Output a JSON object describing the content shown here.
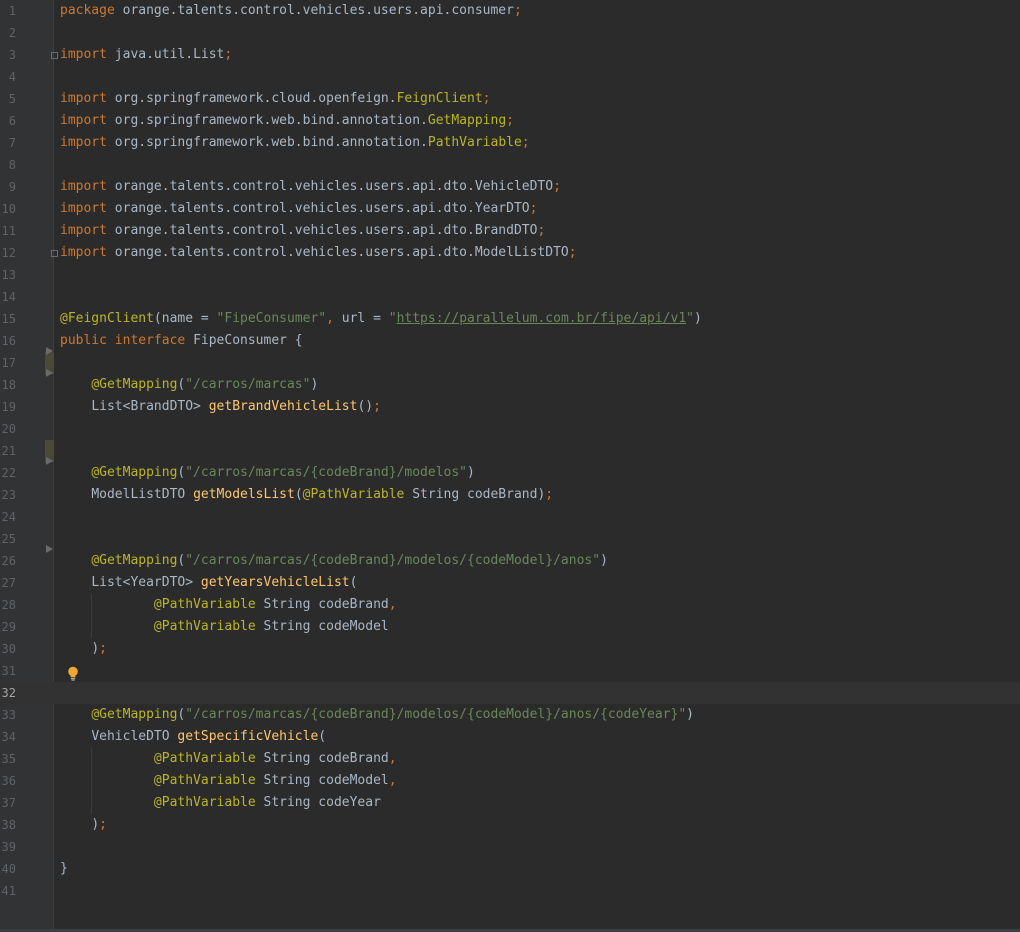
{
  "editor": {
    "current_line": 32,
    "lines": [
      {
        "n": "1",
        "tokens": [
          {
            "t": "package ",
            "c": "kw"
          },
          {
            "t": "orange.talents.control.vehicles.users.api.consumer",
            "c": "id"
          },
          {
            "t": ";",
            "c": "kw"
          }
        ]
      },
      {
        "n": "2",
        "tokens": []
      },
      {
        "n": "3",
        "tokens": [
          {
            "t": "import ",
            "c": "kw"
          },
          {
            "t": "java.util.List",
            "c": "id"
          },
          {
            "t": ";",
            "c": "kw"
          }
        ]
      },
      {
        "n": "4",
        "tokens": []
      },
      {
        "n": "5",
        "tokens": [
          {
            "t": "import ",
            "c": "kw"
          },
          {
            "t": "org.springframework.cloud.openfeign.",
            "c": "id"
          },
          {
            "t": "FeignClient",
            "c": "im"
          },
          {
            "t": ";",
            "c": "kw"
          }
        ]
      },
      {
        "n": "6",
        "tokens": [
          {
            "t": "import ",
            "c": "kw"
          },
          {
            "t": "org.springframework.web.bind.annotation.",
            "c": "id"
          },
          {
            "t": "GetMapping",
            "c": "im"
          },
          {
            "t": ";",
            "c": "kw"
          }
        ]
      },
      {
        "n": "7",
        "tokens": [
          {
            "t": "import ",
            "c": "kw"
          },
          {
            "t": "org.springframework.web.bind.annotation.",
            "c": "id"
          },
          {
            "t": "PathVariable",
            "c": "im"
          },
          {
            "t": ";",
            "c": "kw"
          }
        ]
      },
      {
        "n": "8",
        "tokens": []
      },
      {
        "n": "9",
        "tokens": [
          {
            "t": "import ",
            "c": "kw"
          },
          {
            "t": "orange.talents.control.vehicles.users.api.dto.VehicleDTO",
            "c": "id"
          },
          {
            "t": ";",
            "c": "kw"
          }
        ]
      },
      {
        "n": "10",
        "tokens": [
          {
            "t": "import ",
            "c": "kw"
          },
          {
            "t": "orange.talents.control.vehicles.users.api.dto.YearDTO",
            "c": "id"
          },
          {
            "t": ";",
            "c": "kw"
          }
        ]
      },
      {
        "n": "11",
        "tokens": [
          {
            "t": "import ",
            "c": "kw"
          },
          {
            "t": "orange.talents.control.vehicles.users.api.dto.BrandDTO",
            "c": "id"
          },
          {
            "t": ";",
            "c": "kw"
          }
        ]
      },
      {
        "n": "12",
        "tokens": [
          {
            "t": "import ",
            "c": "kw"
          },
          {
            "t": "orange.talents.control.vehicles.users.api.dto.ModelListDTO",
            "c": "id"
          },
          {
            "t": ";",
            "c": "kw"
          }
        ]
      },
      {
        "n": "13",
        "tokens": []
      },
      {
        "n": "14",
        "tokens": []
      },
      {
        "n": "15",
        "tokens": [
          {
            "t": "@FeignClient",
            "c": "ann"
          },
          {
            "t": "(name = ",
            "c": "id"
          },
          {
            "t": "\"FipeConsumer\"",
            "c": "str"
          },
          {
            "t": ", ",
            "c": "kw"
          },
          {
            "t": "url = ",
            "c": "id"
          },
          {
            "t": "\"",
            "c": "str"
          },
          {
            "t": "https://parallelum.com.br/fipe/api/v1",
            "c": "url"
          },
          {
            "t": "\"",
            "c": "str"
          },
          {
            "t": ")",
            "c": "id"
          }
        ]
      },
      {
        "n": "16",
        "tokens": [
          {
            "t": "public interface ",
            "c": "kw"
          },
          {
            "t": "FipeConsumer {",
            "c": "id"
          }
        ]
      },
      {
        "n": "17",
        "tokens": []
      },
      {
        "n": "18",
        "tokens": [
          {
            "t": "    "
          },
          {
            "t": "@GetMapping",
            "c": "ann"
          },
          {
            "t": "(",
            "c": "id"
          },
          {
            "t": "\"/carros/marcas\"",
            "c": "str"
          },
          {
            "t": ")",
            "c": "id"
          }
        ]
      },
      {
        "n": "19",
        "tokens": [
          {
            "t": "    "
          },
          {
            "t": "List<BrandDTO> ",
            "c": "id"
          },
          {
            "t": "getBrandVehicleList",
            "c": "fn"
          },
          {
            "t": "()",
            "c": "id"
          },
          {
            "t": ";",
            "c": "kw"
          }
        ]
      },
      {
        "n": "20",
        "tokens": []
      },
      {
        "n": "21",
        "tokens": []
      },
      {
        "n": "22",
        "tokens": [
          {
            "t": "    "
          },
          {
            "t": "@GetMapping",
            "c": "ann"
          },
          {
            "t": "(",
            "c": "id"
          },
          {
            "t": "\"/carros/marcas/{codeBrand}/modelos\"",
            "c": "str"
          },
          {
            "t": ")",
            "c": "id"
          }
        ]
      },
      {
        "n": "23",
        "tokens": [
          {
            "t": "    "
          },
          {
            "t": "ModelListDTO ",
            "c": "id"
          },
          {
            "t": "getModelsList",
            "c": "fn"
          },
          {
            "t": "(",
            "c": "id"
          },
          {
            "t": "@PathVariable ",
            "c": "ann"
          },
          {
            "t": "String codeBrand)",
            "c": "id"
          },
          {
            "t": ";",
            "c": "kw"
          }
        ]
      },
      {
        "n": "24",
        "tokens": []
      },
      {
        "n": "25",
        "tokens": []
      },
      {
        "n": "26",
        "tokens": [
          {
            "t": "    "
          },
          {
            "t": "@GetMapping",
            "c": "ann"
          },
          {
            "t": "(",
            "c": "id"
          },
          {
            "t": "\"/carros/marcas/{codeBrand}/modelos/{codeModel}/anos\"",
            "c": "str"
          },
          {
            "t": ")",
            "c": "id"
          }
        ]
      },
      {
        "n": "27",
        "tokens": [
          {
            "t": "    "
          },
          {
            "t": "List<YearDTO> ",
            "c": "id"
          },
          {
            "t": "getYearsVehicleList",
            "c": "fn"
          },
          {
            "t": "(",
            "c": "id"
          }
        ]
      },
      {
        "n": "28",
        "tokens": [
          {
            "t": "            "
          },
          {
            "t": "@PathVariable ",
            "c": "ann"
          },
          {
            "t": "String codeBrand",
            "c": "id"
          },
          {
            "t": ",",
            "c": "kw"
          }
        ]
      },
      {
        "n": "29",
        "tokens": [
          {
            "t": "            "
          },
          {
            "t": "@PathVariable ",
            "c": "ann"
          },
          {
            "t": "String codeModel",
            "c": "id"
          }
        ]
      },
      {
        "n": "30",
        "tokens": [
          {
            "t": "    "
          },
          {
            "t": ")",
            "c": "id"
          },
          {
            "t": ";",
            "c": "kw"
          }
        ]
      },
      {
        "n": "31",
        "tokens": []
      },
      {
        "n": "32",
        "tokens": []
      },
      {
        "n": "33",
        "tokens": [
          {
            "t": "    "
          },
          {
            "t": "@GetMapping",
            "c": "ann"
          },
          {
            "t": "(",
            "c": "id"
          },
          {
            "t": "\"/carros/marcas/{codeBrand}/modelos/{codeModel}/anos/{codeYear}\"",
            "c": "str"
          },
          {
            "t": ")",
            "c": "id"
          }
        ]
      },
      {
        "n": "34",
        "tokens": [
          {
            "t": "    "
          },
          {
            "t": "VehicleDTO ",
            "c": "id"
          },
          {
            "t": "getSpecificVehicle",
            "c": "fn"
          },
          {
            "t": "(",
            "c": "id"
          }
        ]
      },
      {
        "n": "35",
        "tokens": [
          {
            "t": "            "
          },
          {
            "t": "@PathVariable ",
            "c": "ann"
          },
          {
            "t": "String codeBrand",
            "c": "id"
          },
          {
            "t": ",",
            "c": "kw"
          }
        ]
      },
      {
        "n": "36",
        "tokens": [
          {
            "t": "            "
          },
          {
            "t": "@PathVariable ",
            "c": "ann"
          },
          {
            "t": "String codeModel",
            "c": "id"
          },
          {
            "t": ",",
            "c": "kw"
          }
        ]
      },
      {
        "n": "37",
        "tokens": [
          {
            "t": "            "
          },
          {
            "t": "@PathVariable ",
            "c": "ann"
          },
          {
            "t": "String codeYear",
            "c": "id"
          }
        ]
      },
      {
        "n": "38",
        "tokens": [
          {
            "t": "    "
          },
          {
            "t": ")",
            "c": "id"
          },
          {
            "t": ";",
            "c": "kw"
          }
        ]
      },
      {
        "n": "39",
        "tokens": []
      },
      {
        "n": "40",
        "tokens": [
          {
            "t": "}",
            "c": "id"
          }
        ]
      },
      {
        "n": "41",
        "tokens": []
      }
    ]
  },
  "colors": {
    "background": "#2b2b2b",
    "gutter": "#313335",
    "keyword": "#cc7832",
    "identifier": "#a9b7c6",
    "annotation": "#bbb529",
    "string": "#6a8759",
    "method": "#ffc66d",
    "line_number": "#606366",
    "intention_bulb": "#f0a732"
  },
  "icons": {
    "fold": "fold-marker-icon",
    "bulb": "intention-bulb-icon"
  }
}
